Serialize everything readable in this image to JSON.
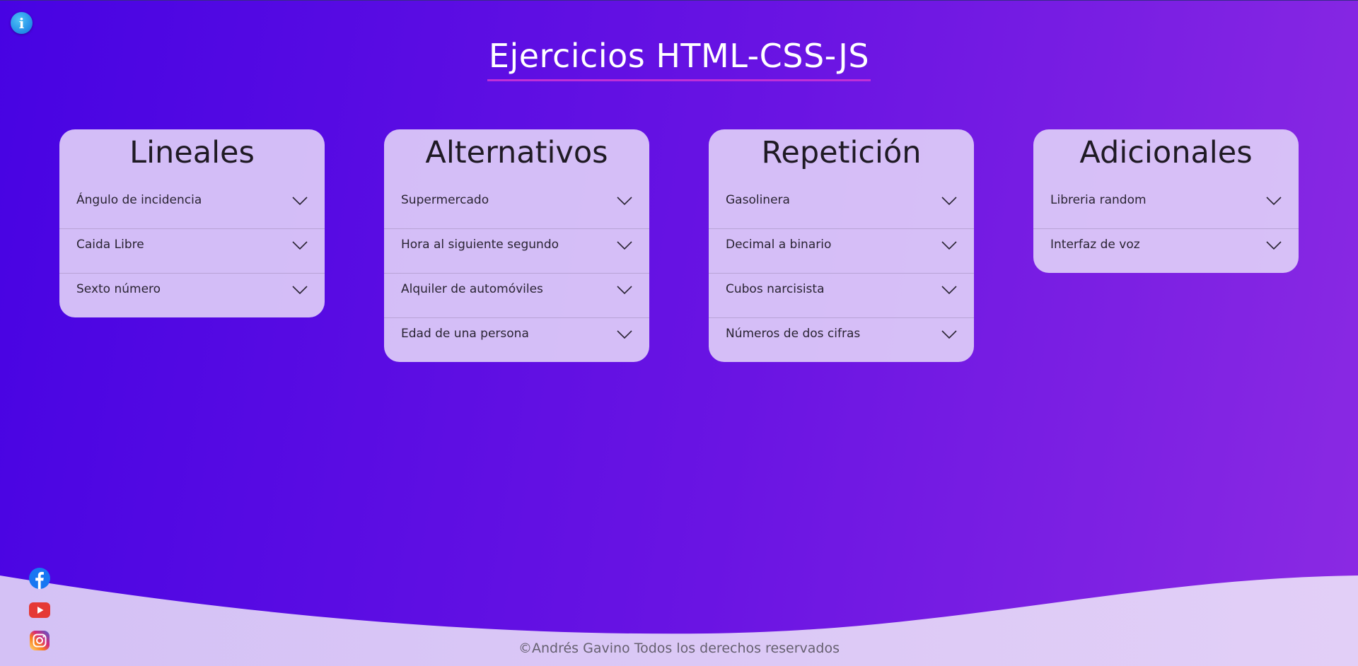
{
  "header": {
    "info_icon": "info-icon",
    "info_glyph": "i",
    "title": "Ejercicios HTML-CSS-JS"
  },
  "cards": [
    {
      "title": "Lineales",
      "items": [
        "Ángulo de incidencia",
        "Caida Libre",
        "Sexto número"
      ]
    },
    {
      "title": "Alternativos",
      "items": [
        "Supermercado",
        "Hora al siguiente segundo",
        "Alquiler de automóviles",
        "Edad de una persona"
      ]
    },
    {
      "title": "Repetición",
      "items": [
        "Gasolinera",
        "Decimal a binario",
        "Cubos narcisista",
        "Números de dos cifras"
      ]
    },
    {
      "title": "Adicionales",
      "items": [
        "Libreria random",
        "Interfaz de voz"
      ]
    }
  ],
  "social": [
    {
      "icon": "facebook-icon",
      "color": "#1877f2"
    },
    {
      "icon": "youtube-icon",
      "color": "#e53935"
    },
    {
      "icon": "instagram-icon",
      "color": "#d6249f"
    }
  ],
  "footer": {
    "text": "©Andrés Gavino Todos los derechos reservados"
  },
  "colors": {
    "background_start": "#4703e3",
    "background_end": "#8b2ae3",
    "card_background": "#decdf8",
    "title_underline": "#c02fd6",
    "footer_wave": "#d8c6f6"
  }
}
